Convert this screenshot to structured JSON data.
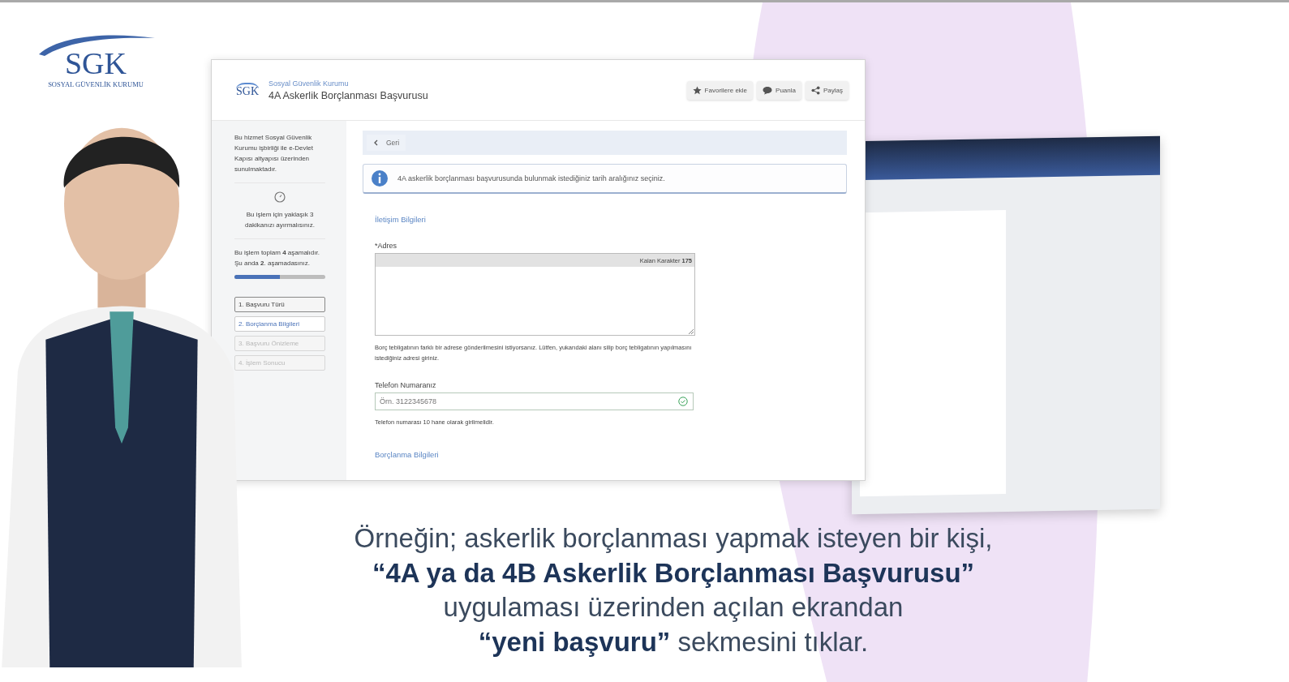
{
  "logo": {
    "text": "SGK",
    "subtitle": "SOSYAL GÜVENLİK KURUMU"
  },
  "window": {
    "org": "Sosyal Güvenlik Kurumu",
    "title": "4A Askerlik Borçlanması Başvurusu",
    "logo_text": "SGK",
    "actions": [
      {
        "kind": "star",
        "label": "Favorilere ekle"
      },
      {
        "kind": "comment",
        "label": "Puanla"
      },
      {
        "kind": "share",
        "label": "Paylaş"
      }
    ]
  },
  "sidebar": {
    "intro": "Bu hizmet Sosyal Güvenlik Kurumu işbirliği ile e-Devlet Kapısı altyapısı üzerinden sunulmaktadır.",
    "time_note": "Bu işlem için yaklaşık 3 dakikanızı ayırmalısınız.",
    "progress_text": "Bu işlem toplam **4** aşamalıdır. Şu anda **2**. aşamadasınız.",
    "progress": {
      "level": 0.5
    },
    "steps": [
      {
        "label": "1. Başvuru Türü",
        "selected": false,
        "disabled": false
      },
      {
        "label": "2. Borçlanma Bilgileri",
        "selected": true,
        "disabled": false
      },
      {
        "label": "3. Başvuru Önizleme",
        "selected": false,
        "disabled": true
      },
      {
        "label": "4. İşlem Sonucu",
        "selected": false,
        "disabled": true
      }
    ]
  },
  "content": {
    "back_button": "Geri",
    "info": "4A askerlik borçlanması başvurusunda bulunmak istediğiniz tarih aralığınız seçiniz.",
    "section_contact": "İletişim Bilgileri",
    "address": {
      "label": "*Adres",
      "counter": "Kalan Karakter **175**",
      "help": "Borç tebligatının farklı bir adrese gönderilmesini istiyorsanız. Lütfen, yukarıdaki alanı silip borç tebligatının yapılmasını istediğiniz adresi giriniz."
    },
    "phone": {
      "label": "Telefon Numaranız",
      "placeholder": "Örn. 3122345678",
      "valid": true,
      "help": "Telefon numarası 10 hane olarak girilmelidir."
    },
    "section_debt": "Borçlanma Bilgileri"
  },
  "caption": [
    "Örneğin; askerlik borçlanması yapmak isteyen bir kişi,",
    "**“4A ya da 4B Askerlik Borçlanması Başvurusu”**",
    "uygulaması üzerinden  açılan ekrandan",
    "**“yeni başvuru”** sekmesini tıklar."
  ]
}
